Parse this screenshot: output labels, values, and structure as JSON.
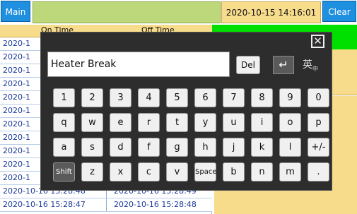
{
  "topbar": {
    "main_label": "Main",
    "datetime": "2020-10-15 14:16:01",
    "clear_label": "Clear"
  },
  "table": {
    "col_on": "On Time",
    "col_off": "Off Time",
    "rows": [
      {
        "on": "2020-1",
        "off": ""
      },
      {
        "on": "2020-1",
        "off": ""
      },
      {
        "on": "2020-1",
        "off": ""
      },
      {
        "on": "2020-1",
        "off": ""
      },
      {
        "on": "2020-1",
        "off": ""
      },
      {
        "on": "2020-1",
        "off": ""
      },
      {
        "on": "2020-1",
        "off": ""
      },
      {
        "on": "2020-1",
        "off": ""
      },
      {
        "on": "2020-1",
        "off": ""
      },
      {
        "on": "2020-1",
        "off": ""
      },
      {
        "on": "2020-1",
        "off": ""
      },
      {
        "on": "2020-10-16 15:28:48",
        "off": "2020-10-16 15:28:49"
      },
      {
        "on": "2020-10-16 15:28:47",
        "off": "2020-10-16 15:28:48"
      }
    ]
  },
  "keyboard": {
    "input_value": "Heater Break",
    "del_label": "Del",
    "enter_icon": "↵",
    "lang_label": "英",
    "lang_sub": "中",
    "close_glyph": "✕",
    "row1": [
      "1",
      "2",
      "3",
      "4",
      "5",
      "6",
      "7",
      "8",
      "9",
      "0"
    ],
    "row2": [
      "q",
      "w",
      "e",
      "r",
      "t",
      "y",
      "u",
      "i",
      "o",
      "p"
    ],
    "row3": [
      "a",
      "s",
      "d",
      "f",
      "g",
      "h",
      "j",
      "k",
      "l",
      "+/-"
    ],
    "row4": [
      "Shift",
      "z",
      "x",
      "c",
      "v",
      "Space",
      "b",
      "n",
      "m",
      "."
    ]
  }
}
